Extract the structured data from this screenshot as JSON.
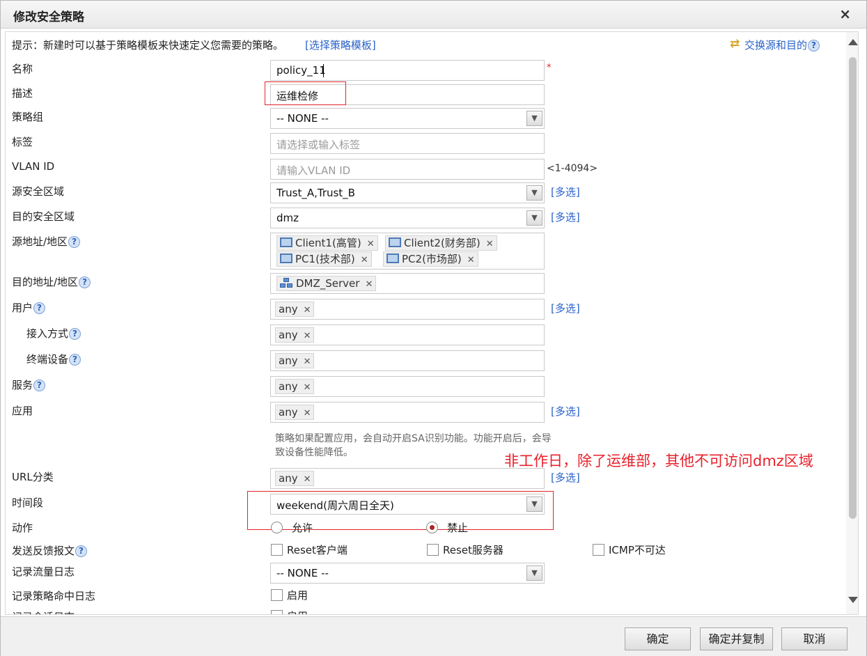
{
  "window": {
    "title": "修改安全策略",
    "close": "×"
  },
  "tip": {
    "text": "提示：新建时可以基于策略模板来快速定义您需要的策略。",
    "link": "[选择策略模板]"
  },
  "swap": {
    "label": "交换源和目的"
  },
  "help_glyph": "?",
  "form": {
    "name": {
      "label": "名称",
      "value": "policy_11",
      "required": "*"
    },
    "desc": {
      "label": "描述",
      "value": "运维检修"
    },
    "group": {
      "label": "策略组",
      "value": "-- NONE --"
    },
    "tag": {
      "label": "标签",
      "placeholder": "请选择或输入标签"
    },
    "vlan": {
      "label": "VLAN ID",
      "placeholder": "请输入VLAN ID",
      "range": "<1-4094>"
    },
    "src_zone": {
      "label": "源安全区域",
      "value": "Trust_A,Trust_B",
      "multi": "[多选]"
    },
    "dst_zone": {
      "label": "目的安全区域",
      "value": "dmz",
      "multi": "[多选]"
    },
    "src_addr": {
      "label": "源地址/地区",
      "tags": [
        "Client1(高管)",
        "Client2(财务部)",
        "PC1(技术部)",
        "PC2(市场部)"
      ]
    },
    "dst_addr": {
      "label": "目的地址/地区",
      "tags": [
        "DMZ_Server"
      ]
    },
    "user": {
      "label": "用户",
      "value": "any",
      "multi": "[多选]"
    },
    "access": {
      "label": "接入方式",
      "value": "any"
    },
    "terminal": {
      "label": "终端设备",
      "value": "any"
    },
    "service": {
      "label": "服务",
      "value": "any"
    },
    "app": {
      "label": "应用",
      "value": "any",
      "multi": "[多选]",
      "note": "策略如果配置应用，会自动开启SA识别功能。功能开启后，会导致设备性能降低。"
    },
    "url": {
      "label": "URL分类",
      "value": "any",
      "multi": "[多选]"
    },
    "time": {
      "label": "时间段",
      "value": "weekend(周六周日全天)"
    },
    "action": {
      "label": "动作",
      "options": [
        "允许",
        "禁止"
      ],
      "selected": "禁止"
    },
    "feedback": {
      "label": "发送反馈报文",
      "options": [
        "Reset客户端",
        "Reset服务器",
        "ICMP不可达"
      ]
    },
    "traffic_log": {
      "label": "记录流量日志",
      "value": "-- NONE --"
    },
    "hit_log": {
      "label": "记录策略命中日志",
      "option": "启用"
    },
    "session_log": {
      "label": "记录会话日志",
      "option": "启用"
    }
  },
  "annotation": "非工作日，除了运维部，其他不可访问dmz区域",
  "buttons": {
    "ok": "确定",
    "ok_copy": "确定并复制",
    "cancel": "取消"
  },
  "colors": {
    "link": "#2a62c9",
    "annotation": "#e8202a",
    "required": "#e8202a"
  }
}
